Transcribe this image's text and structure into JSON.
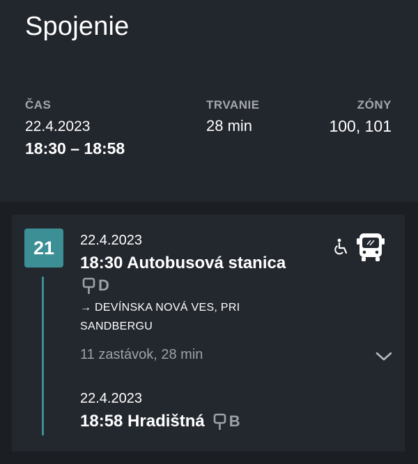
{
  "header": {
    "title": "Spojenie",
    "time_label": "ČAS",
    "date": "22.4.2023",
    "time_range": "18:30 – 18:58",
    "duration_label": "TRVANIE",
    "duration_value": "28 min",
    "zones_label": "ZÓNY",
    "zones_value": "100, 101"
  },
  "segment": {
    "line_number": "21",
    "departure": {
      "date": "22.4.2023",
      "time_stop": "18:30 Autobusová stanica",
      "platform": "D"
    },
    "direction_line1": "→ DEVÍNSKA NOVÁ VES, PRI",
    "direction_line2": "SANDBERGU",
    "stops_summary": "11 zastávok, 28 min",
    "arrival": {
      "date": "22.4.2023",
      "time_stop": "18:58 Hradištná",
      "platform": "B"
    },
    "icons": [
      "wheelchair-icon",
      "bus-icon",
      "chevron-down-icon",
      "bus-stop-sign-icon"
    ]
  },
  "colors": {
    "background": "#22262d",
    "content_background": "#1b1e23",
    "card": "#23272e",
    "accent": "#3b8f95",
    "muted_text": "#9da2a8"
  }
}
